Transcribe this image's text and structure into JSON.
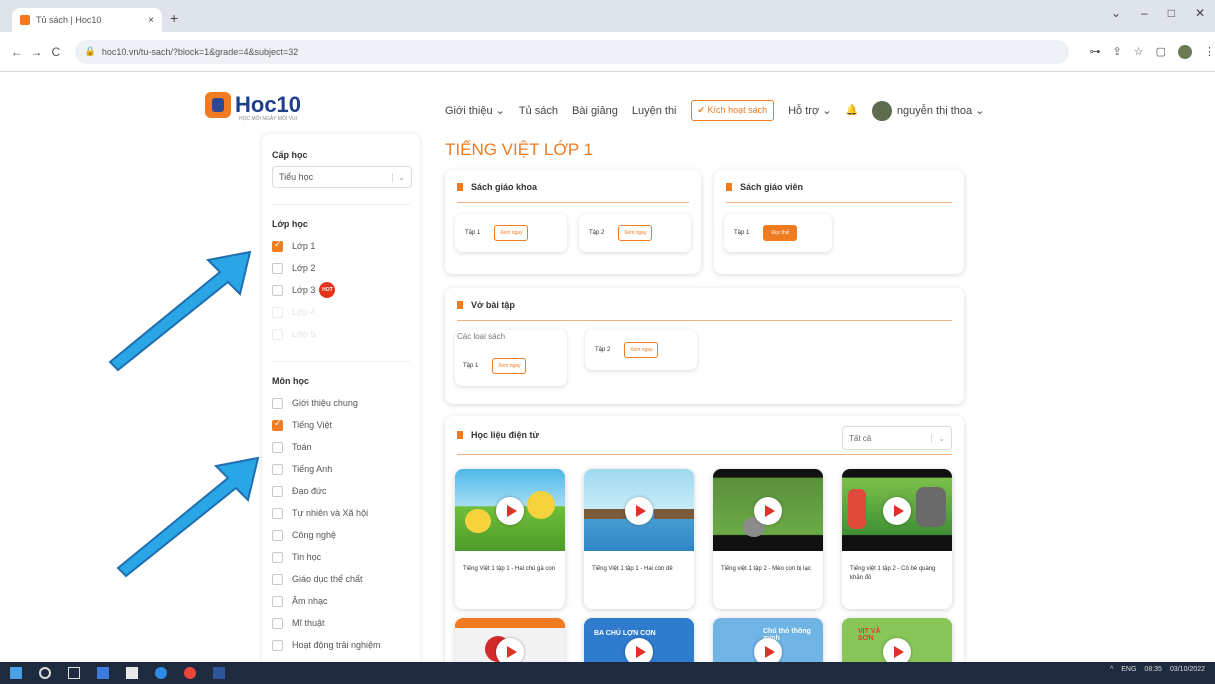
{
  "browser": {
    "tab_title": "Tủ sách | Hoc10",
    "tab_close": "×",
    "new_tab": "+",
    "url": "hoc10.vn/tu-sach/?block=1&grade=4&subject=32",
    "window_controls": [
      "⌄",
      "–",
      "□",
      "✕"
    ],
    "nav": {
      "back": "←",
      "forward": "→",
      "reload": "C"
    }
  },
  "header": {
    "logo_text": "Hoc10",
    "logo_sub": "HỌC MỖI NGÀY MỖI VUI",
    "nav_items": [
      "Giới thiệu ⌄",
      "Tủ sách",
      "Bài giảng",
      "Luyện thi"
    ],
    "activate_label": "✔ Kích hoạt sách",
    "support_label": "Hỗ trợ ⌄",
    "bell": "🔔",
    "user_name": "nguyễn thị thoa ⌄"
  },
  "sidebar": {
    "level_title": "Cấp học",
    "level_value": "Tiểu học",
    "class_title": "Lớp học",
    "classes": [
      {
        "label": "Lớp 1",
        "checked": true
      },
      {
        "label": "Lớp 2",
        "checked": false
      },
      {
        "label": "Lớp 3",
        "checked": false,
        "badge": "HOT"
      },
      {
        "label": "Lớp 4",
        "checked": false,
        "faded": true
      },
      {
        "label": "Lớp 5",
        "checked": false,
        "faded": true
      }
    ],
    "subject_title": "Môn học",
    "subjects": [
      {
        "label": "Giới thiệu chung",
        "checked": false
      },
      {
        "label": "Tiếng Việt",
        "checked": true
      },
      {
        "label": "Toán",
        "checked": false
      },
      {
        "label": "Tiếng Anh",
        "checked": false
      },
      {
        "label": "Đạo đức",
        "checked": false
      },
      {
        "label": "Tự nhiên và Xã hội",
        "checked": false
      },
      {
        "label": "Công nghệ",
        "checked": false
      },
      {
        "label": "Tin học",
        "checked": false
      },
      {
        "label": "Giáo dục thể chất",
        "checked": false
      },
      {
        "label": "Âm nhạc",
        "checked": false
      },
      {
        "label": "Mĩ thuật",
        "checked": false
      },
      {
        "label": "Hoạt động trải nghiệm",
        "checked": false
      }
    ]
  },
  "main": {
    "title": "TIẾNG VIỆT LỚP 1",
    "sgk": {
      "title": "Sách giáo khoa",
      "vol1": "Tập 1",
      "vol2": "Tập 2",
      "btn": "Xem ngay"
    },
    "sgv": {
      "title": "Sách giáo viên",
      "vol1": "Tập 1",
      "btn": "Đọc thử"
    },
    "vbt": {
      "title": "Vở bài tập",
      "broken_alt": "Các loại sách",
      "vol1": "Tập 1",
      "vol2": "Tập 2",
      "btn": "Xem ngay"
    },
    "hl": {
      "title": "Học liệu điện tử",
      "filter": "Tất cả",
      "videos": [
        {
          "title": "Tiếng Việt 1 tập 1 - Hai chú gà con"
        },
        {
          "title": "Tiếng Việt 1 tập 1 - Hai con dê"
        },
        {
          "title": "Tiếng việt 1 tập 2 - Mèo con bị lạc"
        },
        {
          "title": "Tiếng việt 1 tập 2 - Cô bé quàng khăn đỏ"
        }
      ],
      "row2_texts": [
        "BA CHÚ LỢN CON",
        "Chú thỏ thông minh",
        "VỊT VÀ SƠN"
      ]
    }
  },
  "taskbar": {
    "tray": [
      "^",
      "ENG",
      "08:35",
      "03/10/2022"
    ]
  },
  "colors": {
    "accent": "#f07b21",
    "brand": "#1f3f8a",
    "arrow": "#2aa5e6"
  }
}
